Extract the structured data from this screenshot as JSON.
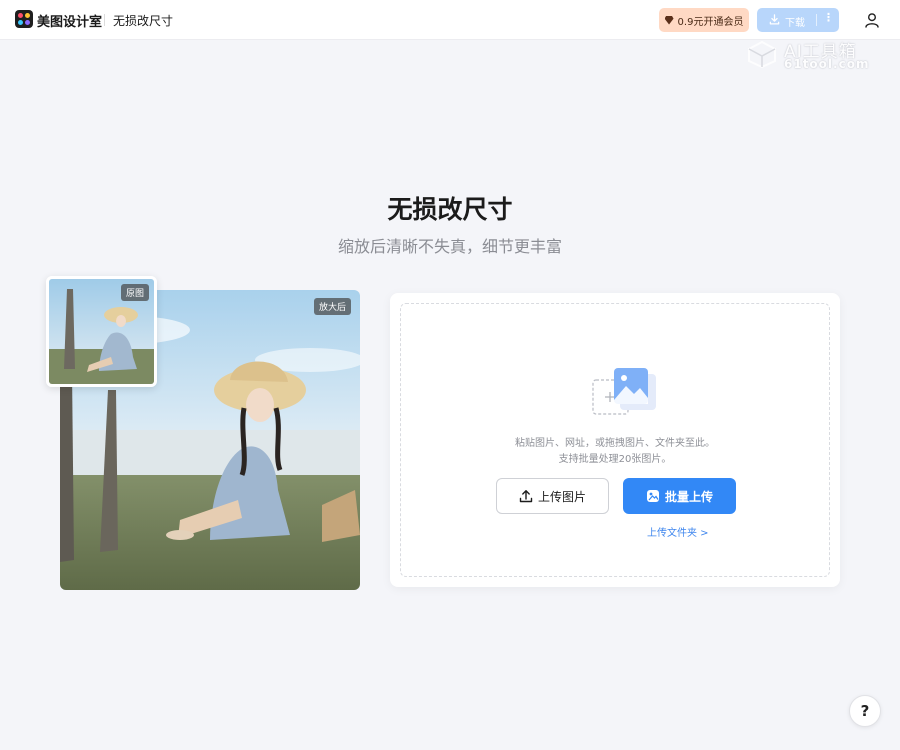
{
  "header": {
    "brand": "美图设计室",
    "page_crumb": "无损改尺寸",
    "vip_button": "0.9元开通会员",
    "download_button": "下载",
    "download_more": "⋮"
  },
  "watermark": {
    "name": "AI工具箱",
    "domain": "61tool.com"
  },
  "hero": {
    "title": "无损改尺寸",
    "subtitle": "缩放后清晰不失真，细节更丰富"
  },
  "compare": {
    "before_tag": "原图",
    "after_tag": "放大后"
  },
  "upload": {
    "hint_line1": "粘贴图片、网址，或拖拽图片、文件夹至此。",
    "hint_line2": "支持批量处理20张图片。",
    "upload_button": "上传图片",
    "batch_button": "批量上传",
    "folder_link": "上传文件夹 >"
  },
  "help": {
    "label": "?"
  },
  "colors": {
    "accent": "#3288f6",
    "vip_bg": "#ffd9c4",
    "download_bg": "#b8d6fb",
    "page_bg": "#f4f5f9"
  },
  "icons": [
    "brand-logo-icon",
    "gem-icon",
    "download-icon",
    "user-icon",
    "upload-icon",
    "batch-upload-icon",
    "image-stack-icon",
    "help-icon"
  ]
}
